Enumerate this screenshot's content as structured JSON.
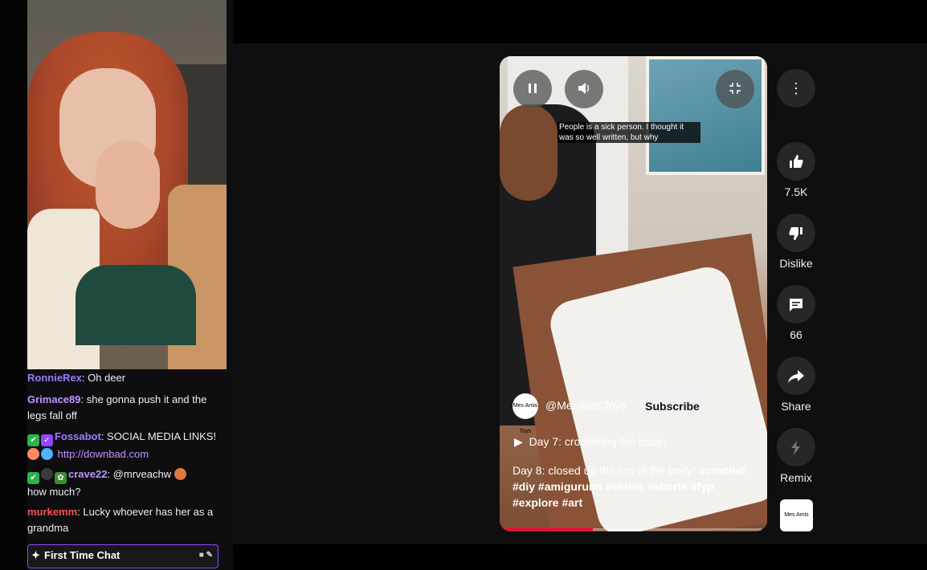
{
  "chat": {
    "messages": [
      {
        "user": "RonnieRex",
        "text": ": Oh deer",
        "color": "#9b7bff"
      },
      {
        "user": "Grimace89",
        "text": ": she gonna push it and the legs fall off",
        "color": "#bf94ff"
      },
      {
        "user": "Fossabot",
        "text": ": SOCIAL MEDIA LINKS!",
        "link": "http://downbad.com",
        "color": "#a27bff"
      },
      {
        "user": "crave22",
        "text": ": @mrveachw",
        "continuation": "how much?",
        "color": "#bf94ff"
      },
      {
        "user": "murkemm",
        "text": ": Lucky whoever has her as a grandma",
        "color": "#ff4c4c"
      }
    ],
    "first_time_chat": "First Time Chat"
  },
  "video": {
    "caption": "People is a sick person. I thought it was so well written, but why",
    "channel_handle": "@MesAmisToys",
    "channel_logo_text": "Mes Amis Toys",
    "subscribe_label": "Subscribe",
    "playlist_title": "Day 7: crocheting the body!",
    "description_text": "Day 8: closed up the top of the body! ",
    "hashtags": [
      "#crochet",
      "#diy",
      "#amigurumi",
      "#series",
      "#shorts",
      "#fyp",
      "#explore",
      "#art"
    ],
    "progress": 0.34
  },
  "rail": {
    "likes": "7.5K",
    "dislike_label": "Dislike",
    "comments": "66",
    "share_label": "Share",
    "remix_label": "Remix"
  },
  "colors": {
    "accent": "#ff0033",
    "twitch_purple": "#9147ff"
  }
}
